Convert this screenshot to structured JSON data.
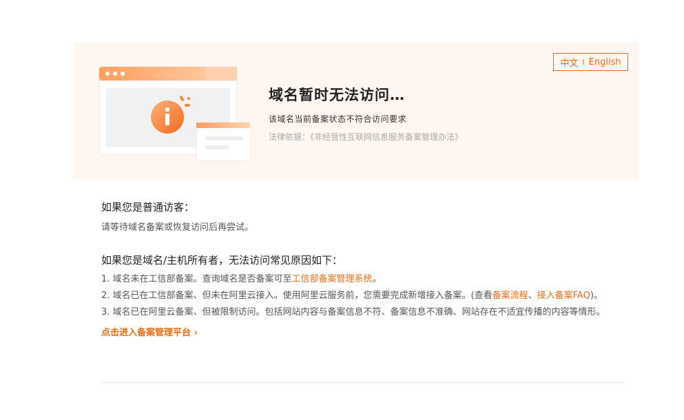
{
  "lang": {
    "zh": "中文",
    "sep": "I",
    "en": "English"
  },
  "banner": {
    "title": "域名暂时无法访问…",
    "subtitle": "该域名当前备案状态不符合访问要求",
    "law": "法律依据：《非经营性互联网信息服务备案管理办法》"
  },
  "visitor": {
    "title": "如果您是普通访客：",
    "text": "请等待域名备案或恢复访问后再尝试。"
  },
  "owner": {
    "title": "如果您是域名/主机所有者，无法访问常见原因如下：",
    "item1_text": "1. 域名未在工信部备案。查询域名是否备案可至",
    "item1_link": "工信部备案管理系统",
    "item1_end": "。",
    "item2_text": "2. 域名已在工信部备案、但未在阿里云接入。使用阿里云服务前，您需要完成新增接入备案。(查看",
    "item2_link1": "备案流程",
    "item2_sep": "、",
    "item2_link2": "接入备案FAQ",
    "item2_end": ")。",
    "item3_text": "3. 域名已在阿里云备案、但被限制访问。包括网站内容与备案信息不符、备案信息不准确、网站存在不适宜传播的内容等情形。",
    "platform_link": "点击进入备案管理平台 ›"
  },
  "colors": {
    "accent": "#e96b12",
    "banner_bg": "#fff6f0"
  },
  "icons": {
    "illustration": "browser-info-illustration",
    "info": "info-icon"
  }
}
